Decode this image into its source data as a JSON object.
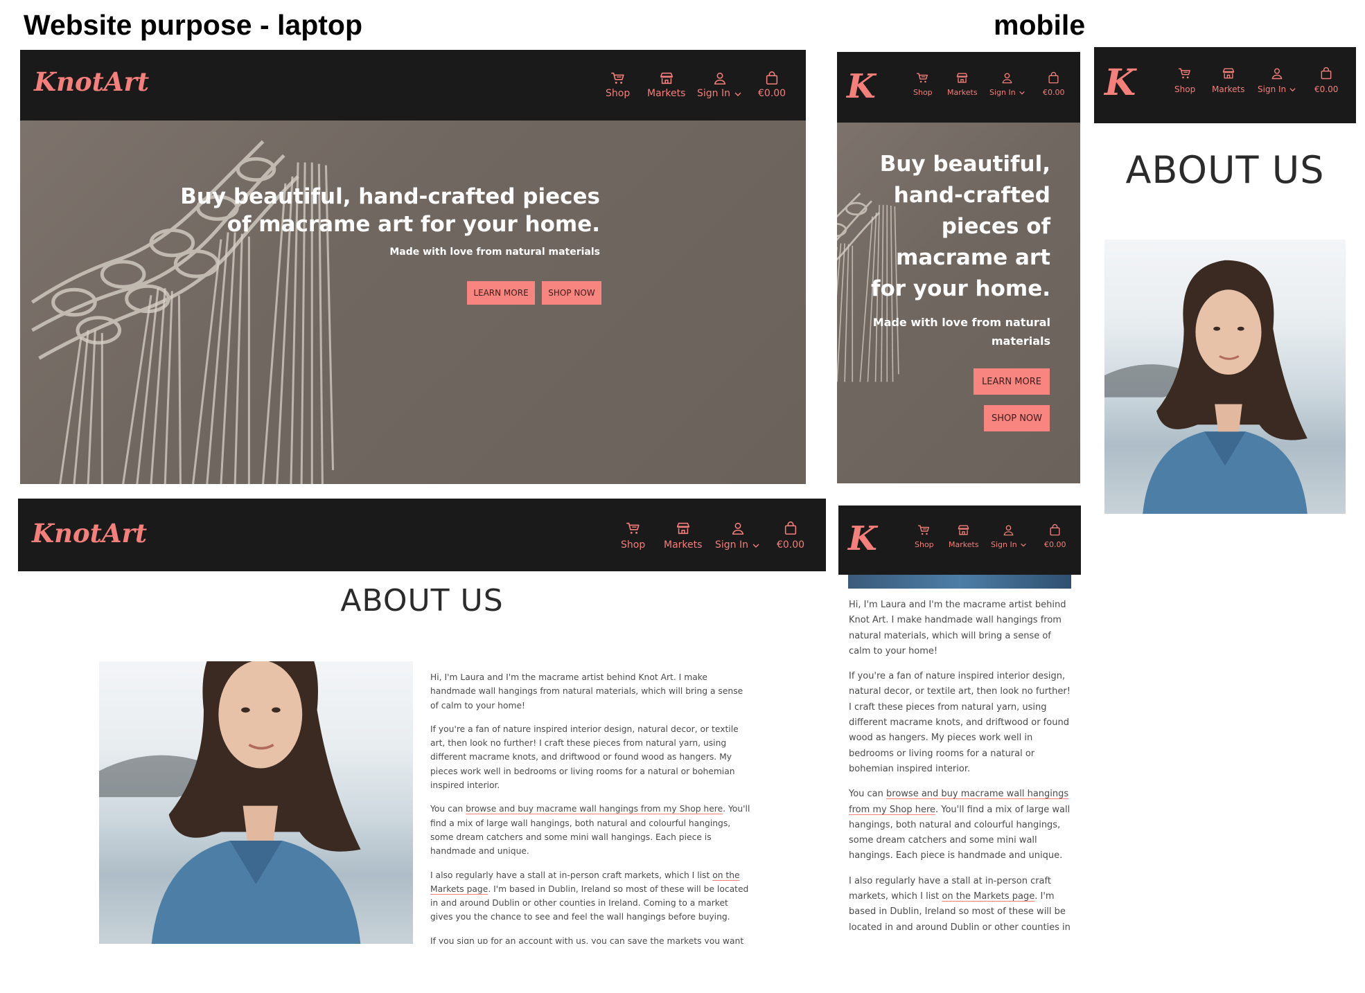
{
  "titles": {
    "laptop": "Website purpose - laptop",
    "mobile": "mobile"
  },
  "brand": {
    "logo_text": "KnotArt",
    "logo_short": "K",
    "accent": "#f47f7b",
    "nav_bg": "#1b1a1b"
  },
  "nav": {
    "shop": "Shop",
    "markets": "Markets",
    "sign_in": "Sign In",
    "cart_total": "€0.00",
    "icons": [
      "cart-icon",
      "storefront-icon",
      "user-icon",
      "chevron-down-icon",
      "bag-icon"
    ]
  },
  "hero": {
    "heading_line1": "Buy beautiful, hand-crafted pieces",
    "heading_line2": "of macrame art for your home.",
    "heading_mobile": [
      "Buy beautiful,",
      "hand-crafted",
      "pieces of",
      "macrame art",
      "for your home."
    ],
    "subheading": "Made with love from natural materials",
    "subheading_mobile": [
      "Made with love from natural",
      "materials"
    ],
    "learn_more": "LEARN MORE",
    "shop_now": "SHOP NOW"
  },
  "about": {
    "heading": "ABOUT US",
    "p1": "Hi, I'm Laura and I'm the macrame artist behind Knot Art. I make handmade wall hangings from natural materials, which will bring a sense of calm to your home!",
    "p2": "If you're a fan of nature inspired interior design, natural decor, or textile art, then look no further! I craft these pieces from natural yarn, using different macrame knots, and driftwood or found wood as hangers. My pieces work well in bedrooms or living rooms for a natural or bohemian inspired interior.",
    "p3_before": "You can ",
    "p3_link": "browse and buy macrame wall hangings from my Shop here",
    "p3_after": ". You'll find a mix of large wall hangings, both natural and colourful hangings, some dream catchers and some mini wall hangings. Each piece is handmade and unique.",
    "p4_before": "I also regularly have a stall at in-person craft markets, which I list ",
    "p4_link": "on the Markets page",
    "p4_after": ". I'm based in Dublin, Ireland so most of these will be located in and around Dublin or other counties in Ireland. Coming to a market gives you the chance to see and feel the wall hangings before buying.",
    "p5_before": "If you ",
    "p5_link": "sign up for an account with us",
    "p5_after": ", you can save the markets you want to go to, and you can also get involved in the conversations with our"
  }
}
